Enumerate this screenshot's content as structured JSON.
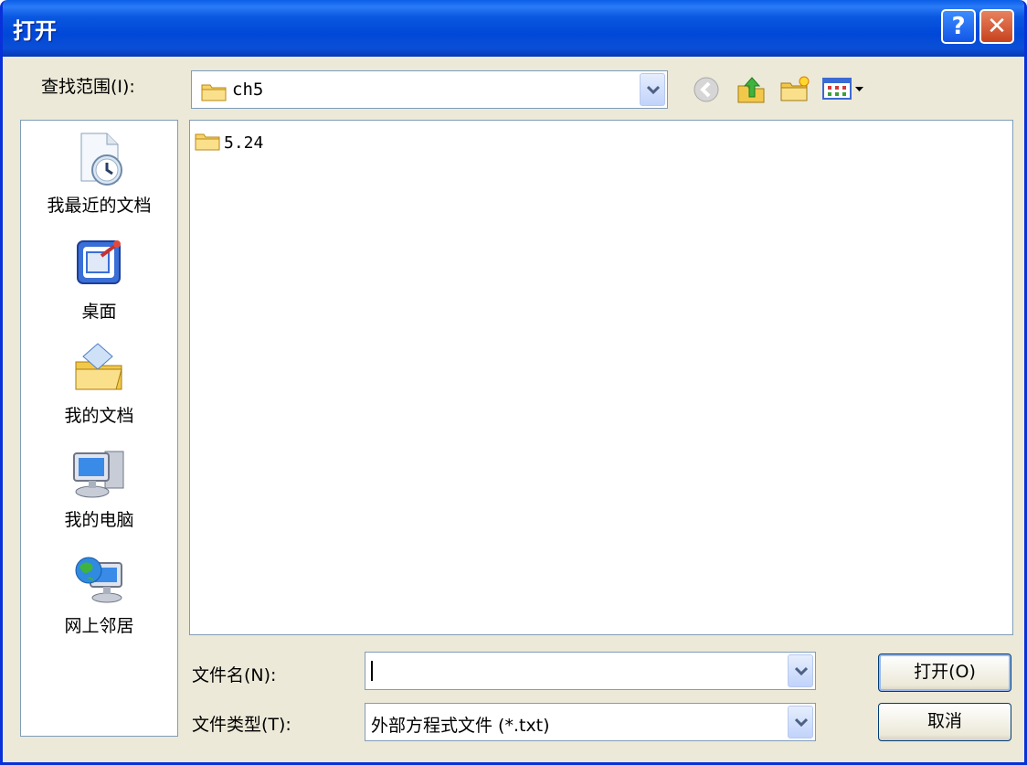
{
  "window": {
    "title": "打开"
  },
  "lookin": {
    "label": "查找范围(I):",
    "value": "ch5"
  },
  "places": [
    {
      "label": "我最近的文档",
      "icon": "recent-documents-icon"
    },
    {
      "label": "桌面",
      "icon": "desktop-icon"
    },
    {
      "label": "我的文档",
      "icon": "my-documents-icon"
    },
    {
      "label": "我的电脑",
      "icon": "my-computer-icon"
    },
    {
      "label": "网上邻居",
      "icon": "network-places-icon"
    }
  ],
  "files": [
    {
      "name": "5.24",
      "icon": "folder-icon"
    }
  ],
  "filename": {
    "label": "文件名(N):",
    "value": ""
  },
  "filetype": {
    "label": "文件类型(T):",
    "value": "外部方程式文件 (*.txt)"
  },
  "buttons": {
    "open": "打开(O)",
    "cancel": "取消"
  },
  "titlebar_buttons": {
    "help": "?",
    "close": "✕"
  },
  "colors": {
    "titlebar": "#0a4fd6",
    "dialog_bg": "#ece9d8",
    "border": "#7f9db9"
  }
}
